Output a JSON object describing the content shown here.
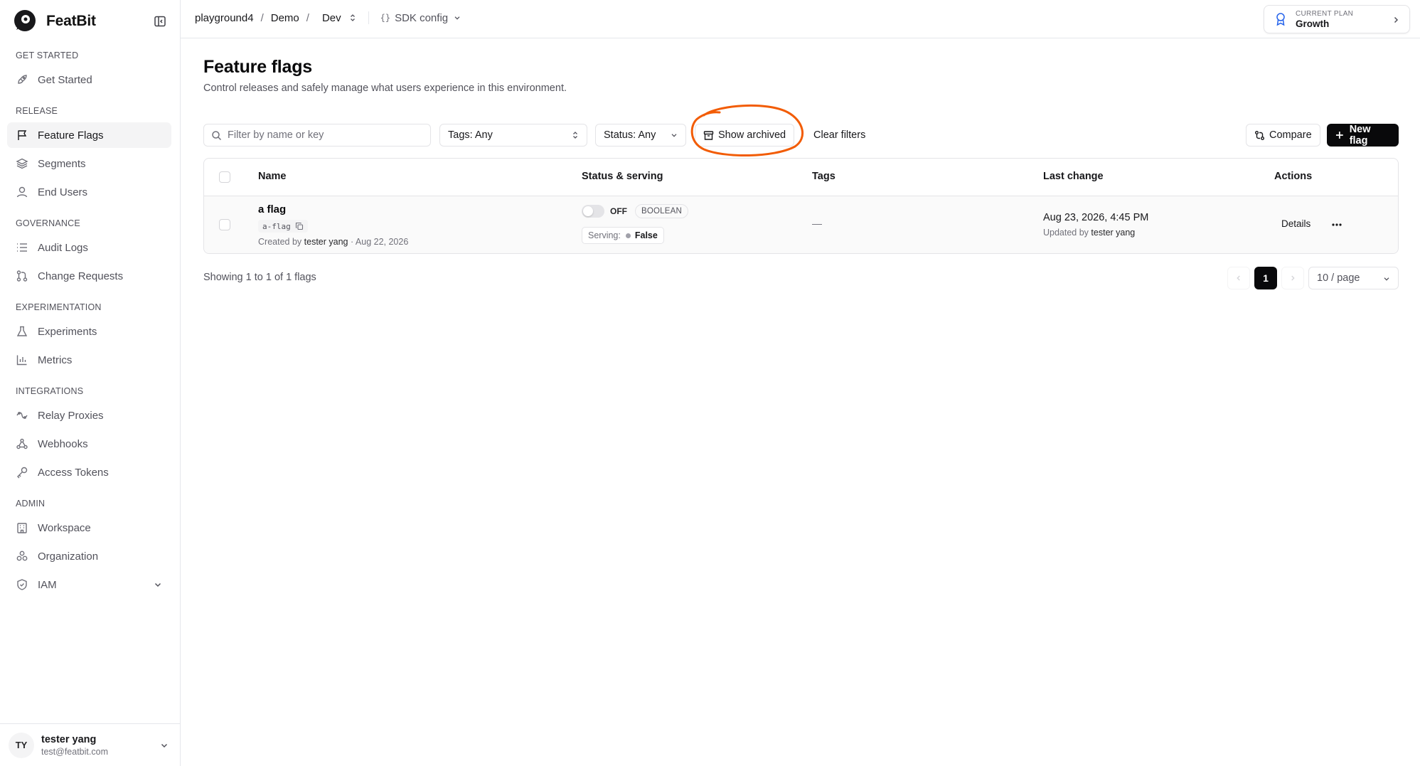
{
  "brand": {
    "name": "FeatBit"
  },
  "sidebar": {
    "sections": [
      {
        "title": "GET STARTED",
        "items": [
          {
            "label": "Get Started",
            "icon": "rocket-icon"
          }
        ]
      },
      {
        "title": "RELEASE",
        "items": [
          {
            "label": "Feature Flags",
            "icon": "flag-icon",
            "active": true
          },
          {
            "label": "Segments",
            "icon": "layers-icon"
          },
          {
            "label": "End Users",
            "icon": "user-icon"
          }
        ]
      },
      {
        "title": "GOVERNANCE",
        "items": [
          {
            "label": "Audit Logs",
            "icon": "list-icon"
          },
          {
            "label": "Change Requests",
            "icon": "git-pull-request-icon"
          }
        ]
      },
      {
        "title": "EXPERIMENTATION",
        "items": [
          {
            "label": "Experiments",
            "icon": "flask-icon"
          },
          {
            "label": "Metrics",
            "icon": "bar-chart-icon"
          }
        ]
      },
      {
        "title": "INTEGRATIONS",
        "items": [
          {
            "label": "Relay Proxies",
            "icon": "relay-icon"
          },
          {
            "label": "Webhooks",
            "icon": "webhook-icon"
          },
          {
            "label": "Access Tokens",
            "icon": "key-icon"
          }
        ]
      },
      {
        "title": "ADMIN",
        "items": [
          {
            "label": "Workspace",
            "icon": "building-icon"
          },
          {
            "label": "Organization",
            "icon": "organization-icon"
          },
          {
            "label": "IAM",
            "icon": "shield-icon",
            "expandable": true
          }
        ]
      }
    ]
  },
  "user": {
    "initials": "TY",
    "name": "tester yang",
    "email": "test@featbit.com"
  },
  "topbar": {
    "breadcrumb": [
      "playground4",
      "Demo",
      "Dev"
    ],
    "sdk_config": "SDK config",
    "plan_label": "CURRENT PLAN",
    "plan_value": "Growth"
  },
  "page": {
    "title": "Feature flags",
    "subtitle": "Control releases and safely manage what users experience in this environment."
  },
  "toolbar": {
    "search_placeholder": "Filter by name or key",
    "tags_filter": "Tags: Any",
    "status_filter": "Status: Any",
    "show_archived": "Show archived",
    "clear_filters": "Clear filters",
    "compare": "Compare",
    "new_flag": "New flag",
    "highlight_color": "#f25c05"
  },
  "table": {
    "columns": [
      "Name",
      "Status & serving",
      "Tags",
      "Last change",
      "Actions"
    ],
    "rows": [
      {
        "name": "a flag",
        "key": "a-flag",
        "created_prefix": "Created by",
        "created_by": "tester yang",
        "created_date": "· Aug 22, 2026",
        "status": "OFF",
        "type": "BOOLEAN",
        "serving_label": "Serving:",
        "serving_value": "False",
        "tags": "—",
        "last_change": "Aug 23, 2026, 4:45 PM",
        "updated_prefix": "Updated by",
        "updated_by": "tester yang",
        "details": "Details"
      }
    ]
  },
  "footer": {
    "showing": "Showing 1 to 1 of 1 flags",
    "current_page": "1",
    "per_page": "10 / page"
  }
}
